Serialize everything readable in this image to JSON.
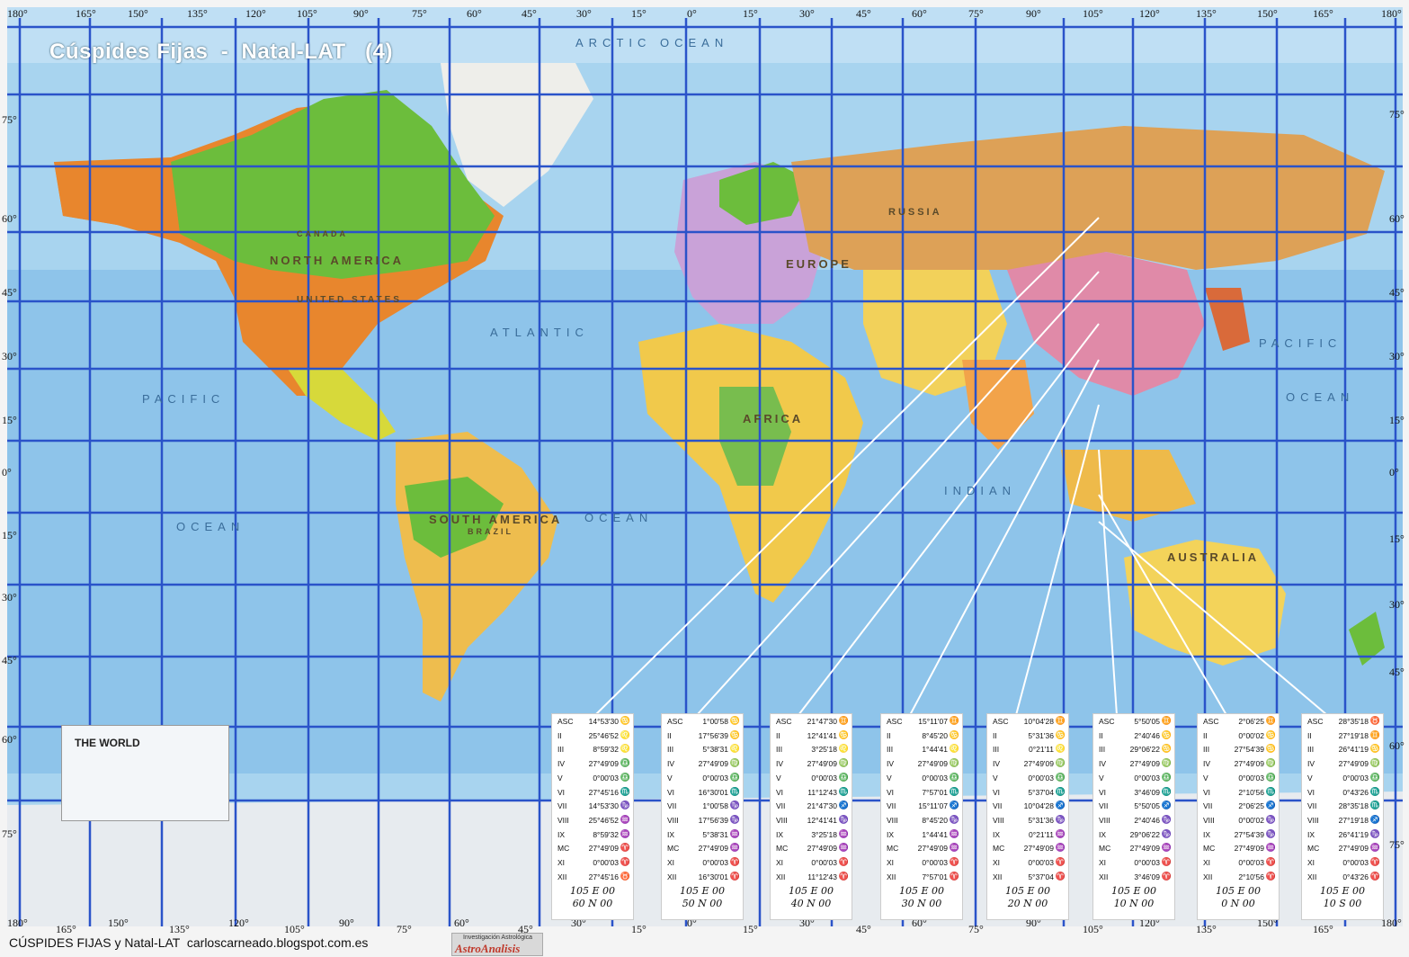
{
  "title": "Cúspides Fijas  -  Natal-LAT   (4)",
  "top_lon_labels": [
    "180°",
    "165°",
    "150°",
    "135°",
    "120°",
    "105°",
    "90°",
    "75°",
    "60°",
    "45°",
    "30°",
    "15°",
    "0°",
    "15°",
    "30°",
    "45°",
    "60°",
    "75°",
    "90°",
    "105°",
    "120°",
    "135°",
    "150°",
    "165°",
    "180°"
  ],
  "bottom_lon_labels": [
    "180°",
    "165°",
    "150°",
    "135°",
    "120°",
    "105°",
    "90°",
    "75°",
    "60°",
    "45°",
    "30°",
    "15°",
    "0°",
    "15°",
    "30°",
    "45°",
    "60°",
    "75°",
    "90°",
    "105°",
    "120°",
    "135°",
    "150°",
    "165°",
    "180°"
  ],
  "lat_labels_left": [
    "75°",
    "60°",
    "45°",
    "30°",
    "15°",
    "0°",
    "15°",
    "30°",
    "45°",
    "60°",
    "75°"
  ],
  "lat_labels_right": [
    "75°",
    "60°",
    "45°",
    "30°",
    "15°",
    "0°",
    "15°",
    "30°",
    "45°",
    "60°",
    "75°"
  ],
  "regions": {
    "north_america": "NORTH AMERICA",
    "south_america": "SOUTH AMERICA",
    "europe": "EUROPE",
    "africa": "AFRICA",
    "australia": "AUSTRALIA",
    "russia": "RUSSIA",
    "united_states": "UNITED STATES",
    "canada": "CANADA",
    "brazil": "BRAZIL"
  },
  "oceans": {
    "arctic": "ARCTIC OCEAN",
    "atlantic": "ATLANTIC",
    "pacific_left": "PACIFIC",
    "pacific_right": "PACIFIC",
    "ocean_left": "OCEAN",
    "ocean_mid": "OCEAN",
    "ocean_right": "OCEAN",
    "indian": "INDIAN"
  },
  "legend_title": "THE WORLD",
  "footer_text": "CÚSPIDES FIJAS y Natal-LAT  carloscarneado.blogspot.com.es",
  "brand": {
    "top": "Investigación Astrológica",
    "name": "AstroAnalisis"
  },
  "house_labels": [
    "ASC",
    "II",
    "III",
    "IV",
    "V",
    "VI",
    "VII",
    "VIII",
    "IX",
    "MC",
    "XI",
    "XII"
  ],
  "cards": [
    {
      "location": [
        "105 E 00",
        "60 N 00"
      ],
      "values": [
        "14°53'30",
        "25°46'52",
        "8°59'32",
        "27°49'09",
        "0°00'03",
        "27°45'16",
        "14°53'30",
        "25°46'52",
        "8°59'32",
        "27°49'09",
        "0°00'03",
        "27°45'16"
      ],
      "signs": [
        "♋",
        "♌",
        "♌",
        "♎",
        "♎",
        "♏",
        "♑",
        "♒",
        "♒",
        "♈",
        "♈",
        "♉"
      ]
    },
    {
      "location": [
        "105 E 00",
        "50 N 00"
      ],
      "values": [
        "1°00'58",
        "17°56'39",
        "5°38'31",
        "27°49'09",
        "0°00'03",
        "16°30'01",
        "1°00'58",
        "17°56'39",
        "5°38'31",
        "27°49'09",
        "0°00'03",
        "16°30'01"
      ],
      "signs": [
        "♋",
        "♋",
        "♌",
        "♍",
        "♎",
        "♏",
        "♑",
        "♑",
        "♒",
        "♒",
        "♈",
        "♈"
      ]
    },
    {
      "location": [
        "105 E 00",
        "40 N 00"
      ],
      "values": [
        "21°47'30",
        "12°41'41",
        "3°25'18",
        "27°49'09",
        "0°00'03",
        "11°12'43",
        "21°47'30",
        "12°41'41",
        "3°25'18",
        "27°49'09",
        "0°00'03",
        "11°12'43"
      ],
      "signs": [
        "♊",
        "♋",
        "♌",
        "♍",
        "♎",
        "♏",
        "♐",
        "♑",
        "♒",
        "♒",
        "♈",
        "♈"
      ]
    },
    {
      "location": [
        "105 E 00",
        "30 N 00"
      ],
      "values": [
        "15°11'07",
        "8°45'20",
        "1°44'41",
        "27°49'09",
        "0°00'03",
        "7°57'01",
        "15°11'07",
        "8°45'20",
        "1°44'41",
        "27°49'09",
        "0°00'03",
        "7°57'01"
      ],
      "signs": [
        "♊",
        "♋",
        "♌",
        "♍",
        "♎",
        "♏",
        "♐",
        "♑",
        "♒",
        "♒",
        "♈",
        "♈"
      ]
    },
    {
      "location": [
        "105 E 00",
        "20 N 00"
      ],
      "values": [
        "10°04'28",
        "5°31'36",
        "0°21'11",
        "27°49'09",
        "0°00'03",
        "5°37'04",
        "10°04'28",
        "5°31'36",
        "0°21'11",
        "27°49'09",
        "0°00'03",
        "5°37'04"
      ],
      "signs": [
        "♊",
        "♋",
        "♌",
        "♍",
        "♎",
        "♏",
        "♐",
        "♑",
        "♒",
        "♒",
        "♈",
        "♈"
      ]
    },
    {
      "location": [
        "105 E 00",
        "10 N 00"
      ],
      "values": [
        "5°50'05",
        "2°40'46",
        "29°06'22",
        "27°49'09",
        "0°00'03",
        "3°46'09",
        "5°50'05",
        "2°40'46",
        "29°06'22",
        "27°49'09",
        "0°00'03",
        "3°46'09"
      ],
      "signs": [
        "♊",
        "♋",
        "♋",
        "♍",
        "♎",
        "♏",
        "♐",
        "♑",
        "♑",
        "♒",
        "♈",
        "♈"
      ]
    },
    {
      "location": [
        "105 E 00",
        "0 N 00"
      ],
      "values": [
        "2°06'25",
        "0°00'02",
        "27°54'39",
        "27°49'09",
        "0°00'03",
        "2°10'56",
        "2°06'25",
        "0°00'02",
        "27°54'39",
        "27°49'09",
        "0°00'03",
        "2°10'56"
      ],
      "signs": [
        "♊",
        "♋",
        "♋",
        "♍",
        "♎",
        "♏",
        "♐",
        "♑",
        "♑",
        "♒",
        "♈",
        "♈"
      ]
    },
    {
      "location": [
        "105 E 00",
        "10 S 00"
      ],
      "values": [
        "28°35'18",
        "27°19'18",
        "26°41'19",
        "27°49'09",
        "0°00'03",
        "0°43'26",
        "28°35'18",
        "27°19'18",
        "26°41'19",
        "27°49'09",
        "0°00'03",
        "0°43'26"
      ],
      "signs": [
        "♉",
        "♊",
        "♋",
        "♍",
        "♎",
        "♏",
        "♏",
        "♐",
        "♑",
        "♒",
        "♈",
        "♈"
      ]
    }
  ]
}
